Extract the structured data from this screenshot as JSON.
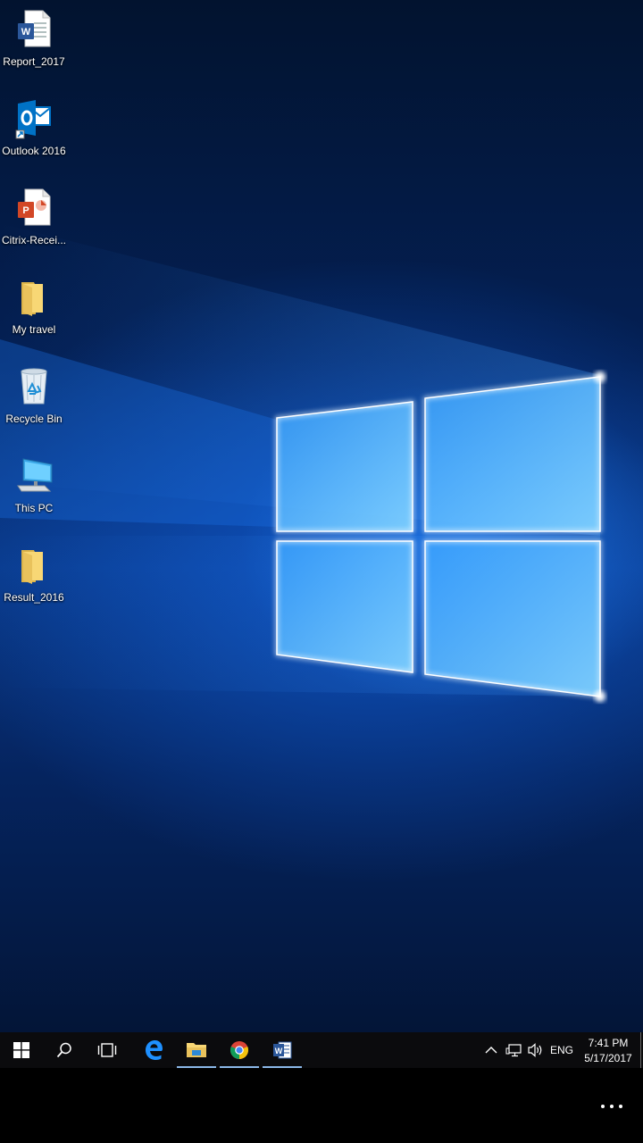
{
  "desktop": {
    "icons": [
      {
        "label": "Report_2017",
        "icon": "word-document-icon"
      },
      {
        "label": "Outlook 2016",
        "icon": "outlook-icon"
      },
      {
        "label": "Citrix-Recei...",
        "icon": "powerpoint-document-icon"
      },
      {
        "label": "My travel",
        "icon": "folder-icon"
      },
      {
        "label": "Recycle Bin",
        "icon": "recycle-bin-icon"
      },
      {
        "label": "This PC",
        "icon": "this-pc-icon"
      },
      {
        "label": "Result_2016",
        "icon": "folder-icon"
      }
    ]
  },
  "taskbar": {
    "apps": [
      {
        "name": "start-button",
        "icon": "windows-logo-icon"
      },
      {
        "name": "search",
        "icon": "search-icon"
      },
      {
        "name": "task-view",
        "icon": "task-view-icon"
      },
      {
        "name": "edge",
        "icon": "edge-icon"
      },
      {
        "name": "file-explorer",
        "icon": "folder-icon",
        "active": true
      },
      {
        "name": "chrome",
        "icon": "chrome-icon",
        "active": true
      },
      {
        "name": "word",
        "icon": "word-icon",
        "active": true
      }
    ],
    "tray": {
      "language": "ENG",
      "time": "7:41 PM",
      "date": "5/17/2017"
    }
  },
  "colors": {
    "accent": "#1e90ff",
    "taskbar": "#0b0b0d",
    "active_indicator": "#8cb8e8"
  }
}
